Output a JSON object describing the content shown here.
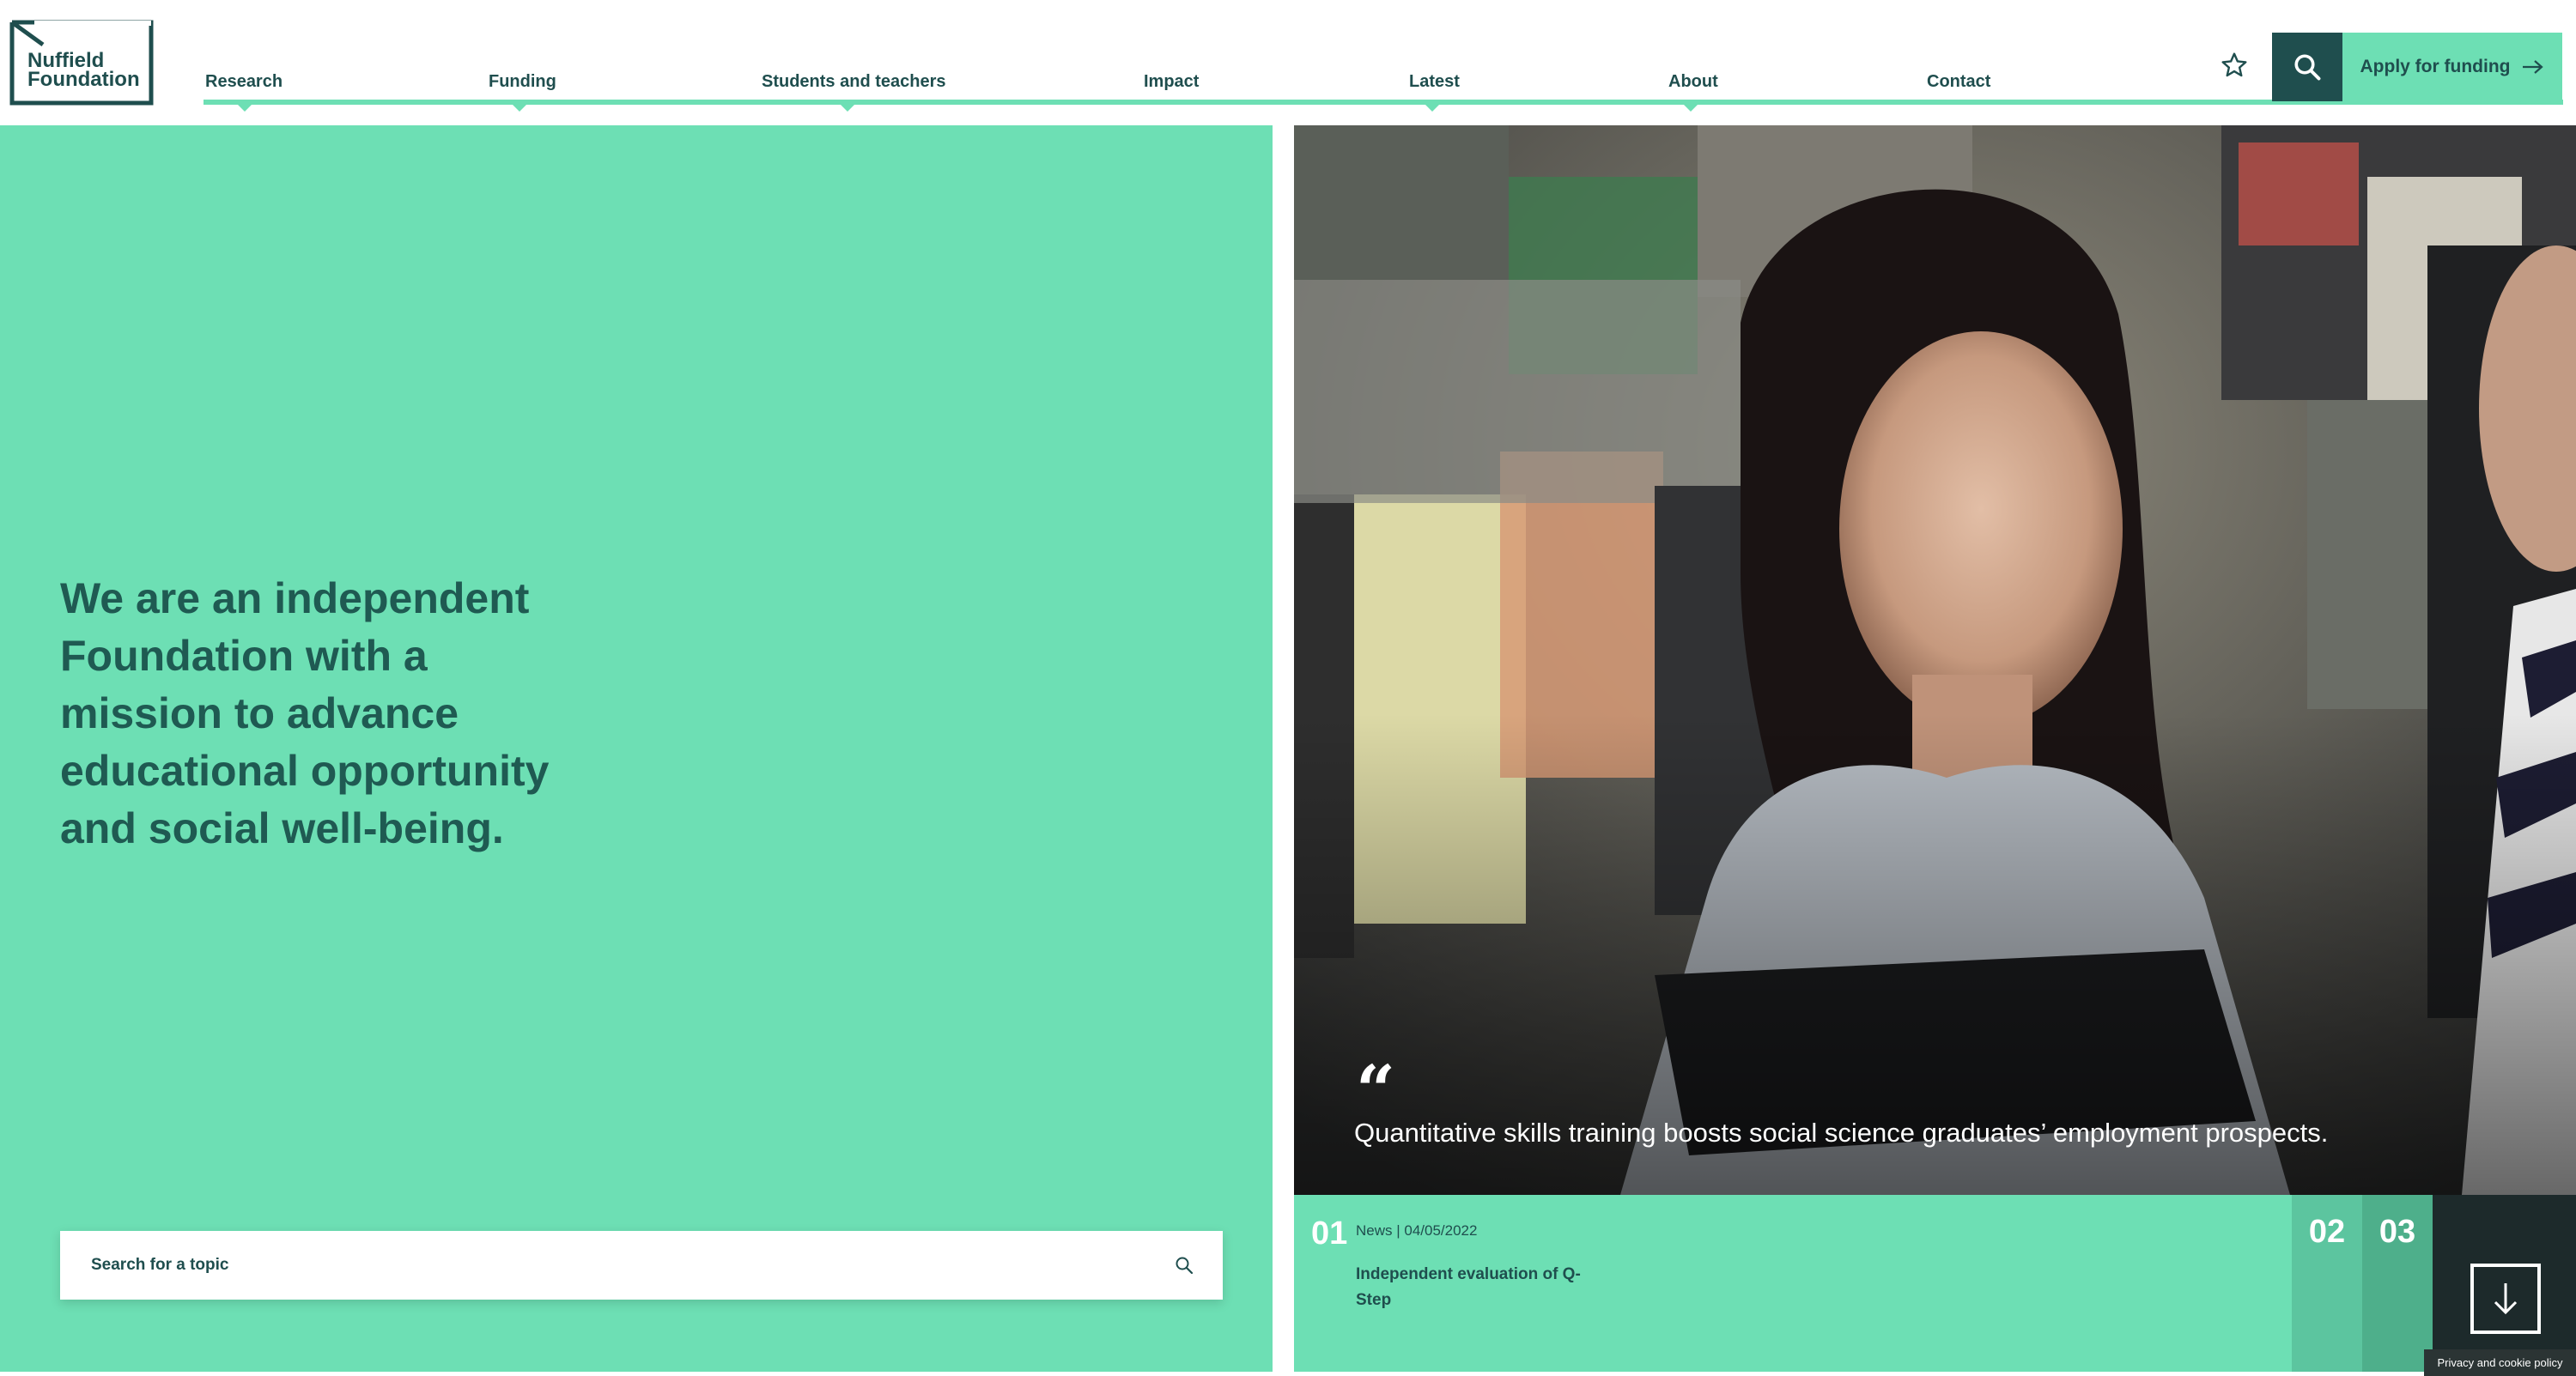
{
  "brand": {
    "name_line1": "Nuffield",
    "name_line2": "Foundation"
  },
  "nav": {
    "items": [
      {
        "label": "Research"
      },
      {
        "label": "Funding"
      },
      {
        "label": "Students and teachers"
      },
      {
        "label": "Impact"
      },
      {
        "label": "Latest"
      },
      {
        "label": "About"
      },
      {
        "label": "Contact"
      }
    ],
    "apply_label": "Apply for funding"
  },
  "hero": {
    "statement": "We are an independent Foundation with a mission to advance educational opportunity and social well-being."
  },
  "search": {
    "placeholder": "Search for a topic"
  },
  "feature": {
    "quote": "Quantitative skills training boosts social science graduates’ employment prospects.",
    "slide_current": "01",
    "meta": "News | 04/05/2022",
    "title": "Independent evaluation of Q-Step",
    "slide_2": "02",
    "slide_3": "03"
  },
  "footer": {
    "privacy": "Privacy and cookie policy"
  },
  "colors": {
    "accent": "#6ddfb4",
    "dark": "#1f4e4e"
  },
  "icons": [
    "star-icon",
    "search-icon",
    "arrow-right-icon",
    "quote-icon",
    "arrow-down-icon"
  ]
}
